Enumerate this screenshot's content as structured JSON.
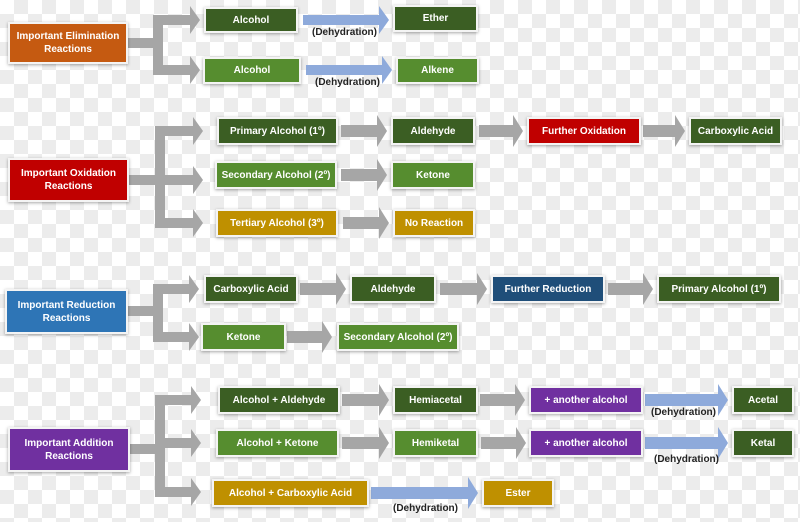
{
  "colors": {
    "gray_arrow": "#a6a6a6",
    "blue_arrow": "#8eaadb",
    "dark_green": "#3b5e23",
    "green": "#568d2f",
    "gold": "#bf9000",
    "red": "#c00000",
    "orange": "#c55a11",
    "blue": "#2e75b6",
    "navy": "#1f4e79",
    "purple": "#7030a0"
  },
  "sections": [
    {
      "title": "Important Elimination Reactions",
      "rows": [
        {
          "steps": [
            "Alcohol",
            "Ether"
          ],
          "arrows": [
            {
              "type": "blue",
              "label": "(Dehydration)"
            }
          ]
        },
        {
          "steps": [
            "Alcohol",
            "Alkene"
          ],
          "arrows": [
            {
              "type": "blue",
              "label": "(Dehydration)"
            }
          ]
        }
      ]
    },
    {
      "title": "Important Oxidation Reactions",
      "rows": [
        {
          "steps": [
            "Primary Alcohol (1º)",
            "Aldehyde",
            "Further Oxidation",
            "Carboxylic Acid"
          ],
          "arrows": [
            {
              "type": "gray"
            },
            {
              "type": "gray"
            },
            {
              "type": "gray"
            }
          ]
        },
        {
          "steps": [
            "Secondary Alcohol (2º)",
            "Ketone"
          ],
          "arrows": [
            {
              "type": "gray"
            }
          ]
        },
        {
          "steps": [
            "Tertiary Alcohol (3º)",
            "No Reaction"
          ],
          "arrows": [
            {
              "type": "gray"
            }
          ]
        }
      ]
    },
    {
      "title": "Important Reduction Reactions",
      "rows": [
        {
          "steps": [
            "Carboxylic Acid",
            "Aldehyde",
            "Further Reduction",
            "Primary Alcohol (1º)"
          ],
          "arrows": [
            {
              "type": "gray"
            },
            {
              "type": "gray"
            },
            {
              "type": "gray"
            }
          ]
        },
        {
          "steps": [
            "Ketone",
            "Secondary Alcohol (2º)"
          ],
          "arrows": [
            {
              "type": "gray"
            }
          ]
        }
      ]
    },
    {
      "title": "Important Addition Reactions",
      "rows": [
        {
          "steps": [
            "Alcohol + Aldehyde",
            "Hemiacetal",
            "+ another alcohol",
            "Acetal"
          ],
          "arrows": [
            {
              "type": "gray"
            },
            {
              "type": "gray"
            },
            {
              "type": "blue",
              "label": "(Dehydration)"
            }
          ]
        },
        {
          "steps": [
            "Alcohol + Ketone",
            "Hemiketal",
            "+ another alcohol",
            "Ketal"
          ],
          "arrows": [
            {
              "type": "gray"
            },
            {
              "type": "gray"
            },
            {
              "type": "blue",
              "label": "(Dehydration)"
            }
          ]
        },
        {
          "steps": [
            "Alcohol + Carboxylic Acid",
            "Ester"
          ],
          "arrows": [
            {
              "type": "blue",
              "label": "(Dehydration)"
            }
          ]
        }
      ]
    }
  ]
}
